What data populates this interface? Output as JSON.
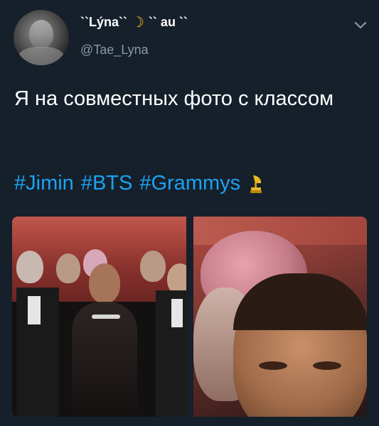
{
  "tweet": {
    "display_name_part1": "``Lýna``",
    "display_name_part2": "`` au ``",
    "name_icon": "crescent-moon",
    "handle": "@Tae_Lyna",
    "text": "Я на совместных фото с классом",
    "hashtags": [
      "#Jimin",
      "#BTS",
      "#Grammys"
    ],
    "trailing_icon": "grammy-gramophone"
  },
  "colors": {
    "background": "#15202b",
    "text": "#ffffff",
    "secondary_text": "#8899a6",
    "link": "#1da1f2"
  },
  "media": {
    "count": 2,
    "images": [
      "group-photo",
      "zoomed-face-photo"
    ]
  }
}
